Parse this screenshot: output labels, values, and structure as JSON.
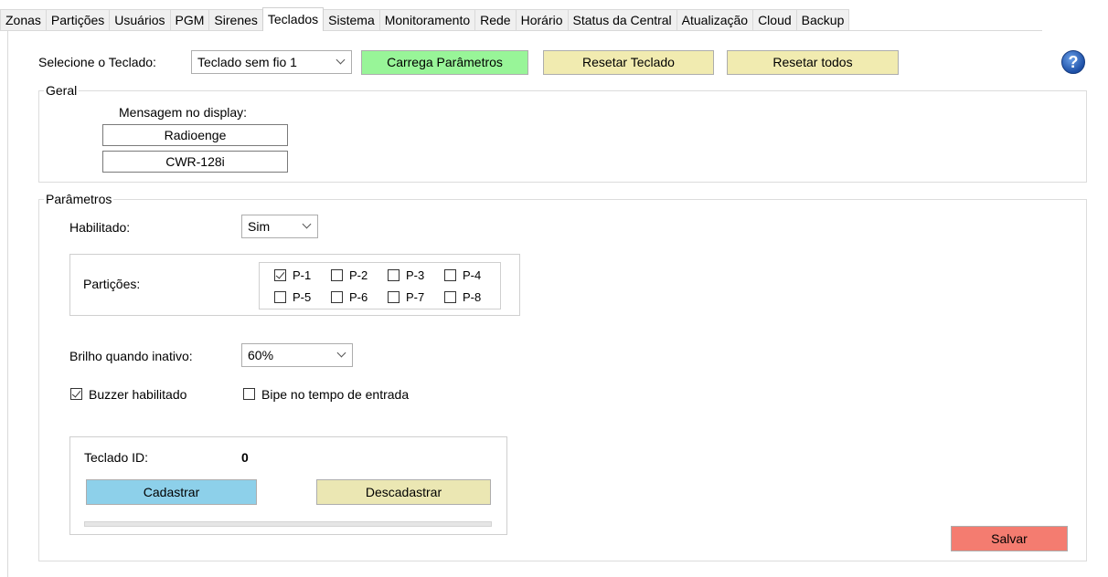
{
  "tabs": [
    "Zonas",
    "Partições",
    "Usuários",
    "PGM",
    "Sirenes",
    "Teclados",
    "Sistema",
    "Monitoramento",
    "Rede",
    "Horário",
    "Status da Central",
    "Atualização",
    "Cloud",
    "Backup"
  ],
  "active_tab": "Teclados",
  "top": {
    "select_label": "Selecione o Teclado:",
    "keyboard_select": "Teclado sem fio 1",
    "load_button": "Carrega Parâmetros",
    "reset_button": "Resetar Teclado",
    "reset_all_button": "Resetar todos",
    "help_glyph": "?"
  },
  "geral": {
    "legend": "Geral",
    "display_label": "Mensagem no display:",
    "line1": "Radioenge",
    "line2": "CWR-128i"
  },
  "params": {
    "legend": "Parâmetros",
    "enabled_label": "Habilitado:",
    "enabled_value": "Sim",
    "partitions_label": "Partições:",
    "partitions": [
      {
        "label": "P-1",
        "checked": true
      },
      {
        "label": "P-2",
        "checked": false
      },
      {
        "label": "P-3",
        "checked": false
      },
      {
        "label": "P-4",
        "checked": false
      },
      {
        "label": "P-5",
        "checked": false
      },
      {
        "label": "P-6",
        "checked": false
      },
      {
        "label": "P-7",
        "checked": false
      },
      {
        "label": "P-8",
        "checked": false
      }
    ],
    "brightness_label": "Brilho quando inativo:",
    "brightness_value": "60%",
    "buzzer_label": "Buzzer habilitado",
    "buzzer_checked": true,
    "beep_label": "Bipe no tempo de entrada",
    "beep_checked": false,
    "keyboard_id_label": "Teclado ID:",
    "keyboard_id_value": "0",
    "register_button": "Cadastrar",
    "unregister_button": "Descadastrar",
    "progress": 0,
    "save_button": "Salvar"
  },
  "colors": {
    "load_button": "#98f598",
    "reset_button": "#f1ebb0",
    "register_button": "#8dd0ea",
    "unregister_button": "#ebe7b3",
    "save_button": "#f47c70"
  }
}
